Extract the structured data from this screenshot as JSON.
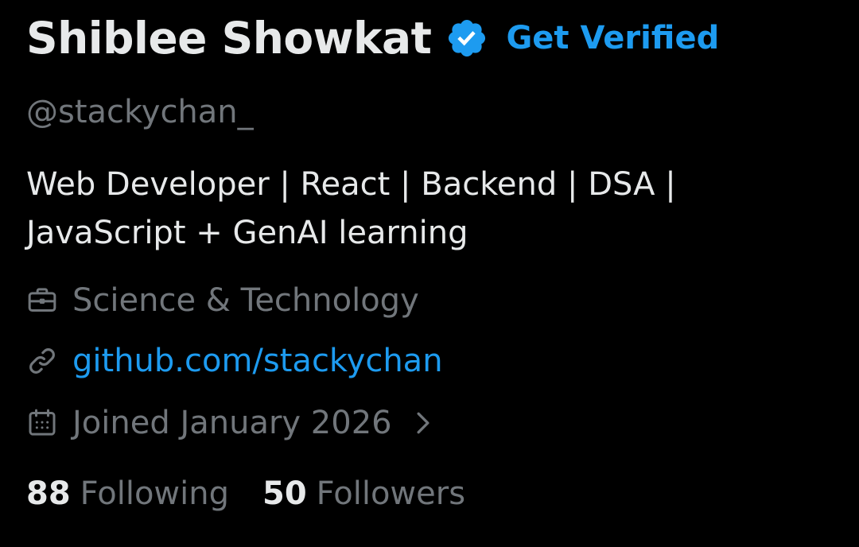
{
  "profile": {
    "display_name": "Shiblee Showkat",
    "verified_icon": "verified-badge-icon",
    "get_verified_label": "Get Verified",
    "handle": "@stackychan_",
    "bio_line1": "Web Developer | React | Backend | DSA |",
    "bio_line2": "JavaScript + GenAI learning",
    "category": {
      "icon": "briefcase-icon",
      "text": "Science & Technology"
    },
    "website": {
      "icon": "link-icon",
      "text": "github.com/stackychan"
    },
    "joined": {
      "icon": "calendar-icon",
      "text": "Joined January 2026",
      "chevron_icon": "chevron-right-icon"
    },
    "stats": {
      "following_count": "88",
      "following_label": "Following",
      "followers_count": "50",
      "followers_label": "Followers"
    }
  },
  "colors": {
    "background": "#000000",
    "primary_text": "#e7e9ea",
    "secondary_text": "#71767b",
    "accent": "#1d9bf0"
  }
}
